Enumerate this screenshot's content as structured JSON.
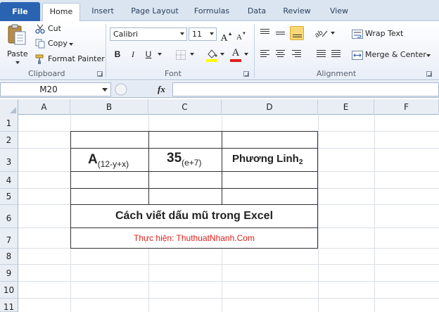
{
  "tabs": [
    "File",
    "Home",
    "Insert",
    "Page Layout",
    "Formulas",
    "Data",
    "Review",
    "View"
  ],
  "clipboard": {
    "paste": "Paste",
    "cut": "Cut",
    "copy": "Copy",
    "format_painter": "Format Painter",
    "label": "Clipboard"
  },
  "font": {
    "name": "Calibri",
    "size": "11",
    "bold": "B",
    "italic": "I",
    "underline": "U",
    "grow": "A",
    "shrink": "A",
    "font_color_glyph": "A",
    "label": "Font"
  },
  "alignment": {
    "wrap_text": "Wrap Text",
    "merge_center": "Merge & Center",
    "label": "Alignment"
  },
  "formula_bar": {
    "name_box": "M20",
    "fx": "fx",
    "formula": ""
  },
  "columns": [
    "A",
    "B",
    "C",
    "D",
    "E",
    "F"
  ],
  "rows": [
    "1",
    "2",
    "3",
    "4",
    "5",
    "6",
    "7",
    "8",
    "9",
    "10",
    "11"
  ],
  "cells": {
    "b3_main": "A",
    "b3_sub": "(12-y+x)",
    "c3_main": "35",
    "c3_sub": "(e+7)",
    "d3_main": "Phương Linh",
    "d3_sub": "2",
    "b6": "Cách viết dấu mũ trong Excel",
    "b7": "Thực hiện: ThuthuatNhanh.Com"
  },
  "colors": {
    "file_tab": "#2a63b1",
    "b7_text": "#e0201b",
    "active_button": "#fbd873"
  },
  "icons": {
    "paste": "paste-icon",
    "cut": "scissors-icon",
    "copy": "copy-icon",
    "format_painter": "brush-icon",
    "borders": "borders-icon",
    "fill_color": "fill-bucket-icon",
    "function": "fx-icon"
  }
}
